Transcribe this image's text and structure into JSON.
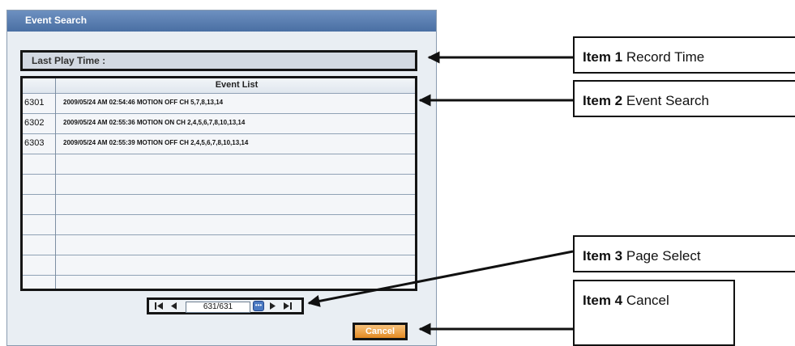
{
  "dialog": {
    "title": "Event Search",
    "last_play_label": "Last Play Time :",
    "list_header": "Event List",
    "events": [
      {
        "id": "6301",
        "text": "2009/05/24 AM 02:54:46   MOTION OFF CH 5,7,8,13,14"
      },
      {
        "id": "6302",
        "text": "2009/05/24 AM 02:55:36   MOTION ON CH 2,4,5,6,7,8,10,13,14"
      },
      {
        "id": "6303",
        "text": "2009/05/24 AM 02:55:39   MOTION OFF CH 2,4,5,6,7,8,10,13,14"
      }
    ],
    "page_value": "631/631",
    "cancel_label": "Cancel"
  },
  "callouts": [
    {
      "item": "Item 1",
      "desc": "Record Time"
    },
    {
      "item": "Item 2",
      "desc": "Event Search"
    },
    {
      "item": "Item 3",
      "desc": "Page Select"
    },
    {
      "item": "Item 4",
      "desc": "Cancel"
    }
  ]
}
